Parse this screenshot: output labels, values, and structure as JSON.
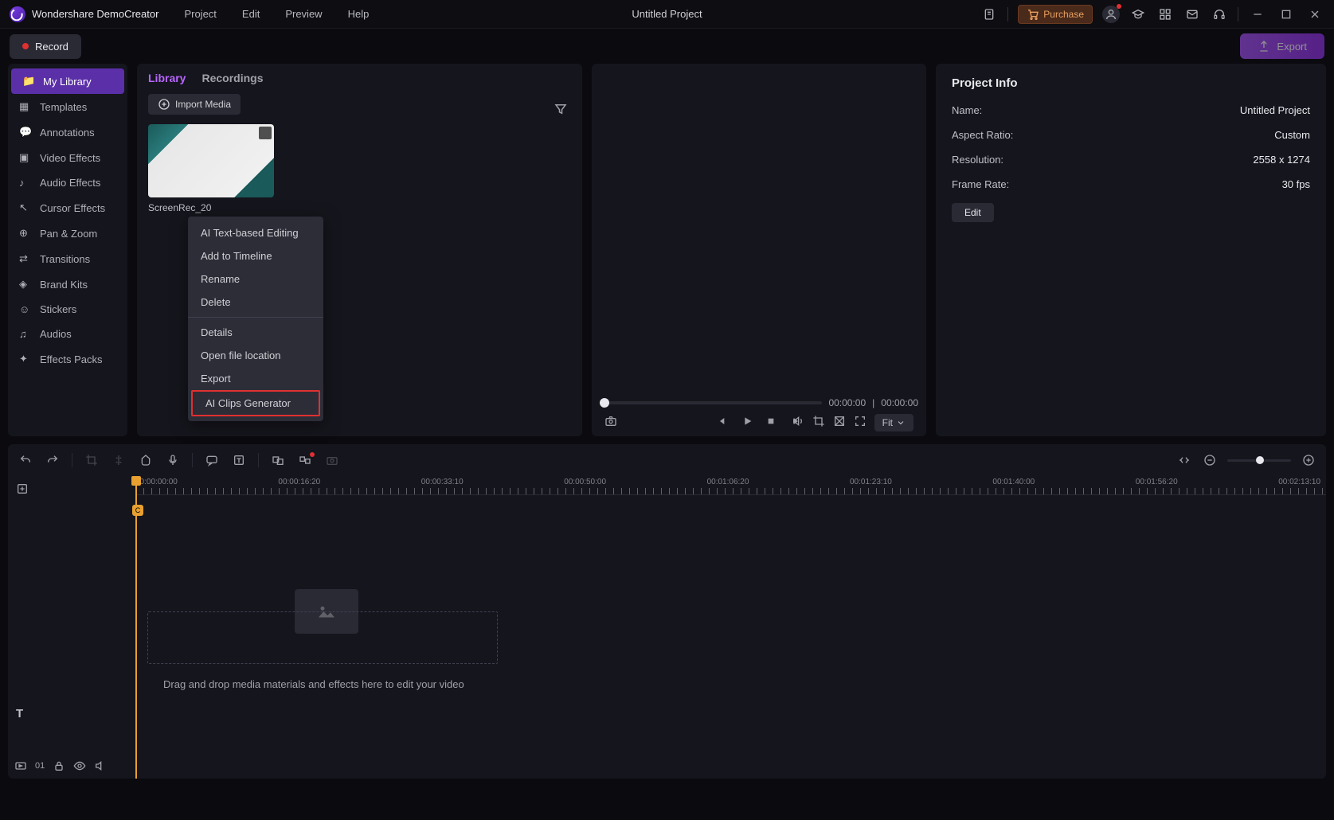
{
  "titlebar": {
    "appname": "Wondershare DemoCreator",
    "menus": [
      "Project",
      "Edit",
      "Preview",
      "Help"
    ],
    "project_title": "Untitled Project",
    "purchase": "Purchase"
  },
  "actionbar": {
    "record": "Record",
    "export": "Export"
  },
  "sidebar": {
    "items": [
      {
        "label": "My Library",
        "active": true
      },
      {
        "label": "Templates"
      },
      {
        "label": "Annotations"
      },
      {
        "label": "Video Effects"
      },
      {
        "label": "Audio Effects"
      },
      {
        "label": "Cursor Effects"
      },
      {
        "label": "Pan & Zoom"
      },
      {
        "label": "Transitions"
      },
      {
        "label": "Brand Kits"
      },
      {
        "label": "Stickers"
      },
      {
        "label": "Audios"
      },
      {
        "label": "Effects Packs"
      }
    ]
  },
  "library": {
    "tabs": [
      "Library",
      "Recordings"
    ],
    "import": "Import Media",
    "media_name": "ScreenRec_20"
  },
  "context_menu": {
    "group1": [
      "AI Text-based Editing",
      "Add to Timeline",
      "Rename",
      "Delete"
    ],
    "group2": [
      "Details",
      "Open file location",
      "Export",
      "AI Clips Generator"
    ],
    "highlighted": "AI Clips Generator"
  },
  "preview": {
    "time_current": "00:00:00",
    "time_total": "00:00:00",
    "fit": "Fit"
  },
  "project_info": {
    "title": "Project Info",
    "rows": [
      {
        "label": "Name:",
        "value": "Untitled Project"
      },
      {
        "label": "Aspect Ratio:",
        "value": "Custom"
      },
      {
        "label": "Resolution:",
        "value": "2558 x 1274"
      },
      {
        "label": "Frame Rate:",
        "value": "30 fps"
      }
    ],
    "edit": "Edit"
  },
  "timeline": {
    "ticks": [
      "00:00:00:00",
      "00:00:16:20",
      "00:00:33:10",
      "00:00:50:00",
      "00:01:06:20",
      "00:01:23:10",
      "00:01:40:00",
      "00:01:56:20",
      "00:02:13:10"
    ],
    "drop_hint": "Drag and drop media materials and effects here to edit your video",
    "track_count": "01"
  }
}
